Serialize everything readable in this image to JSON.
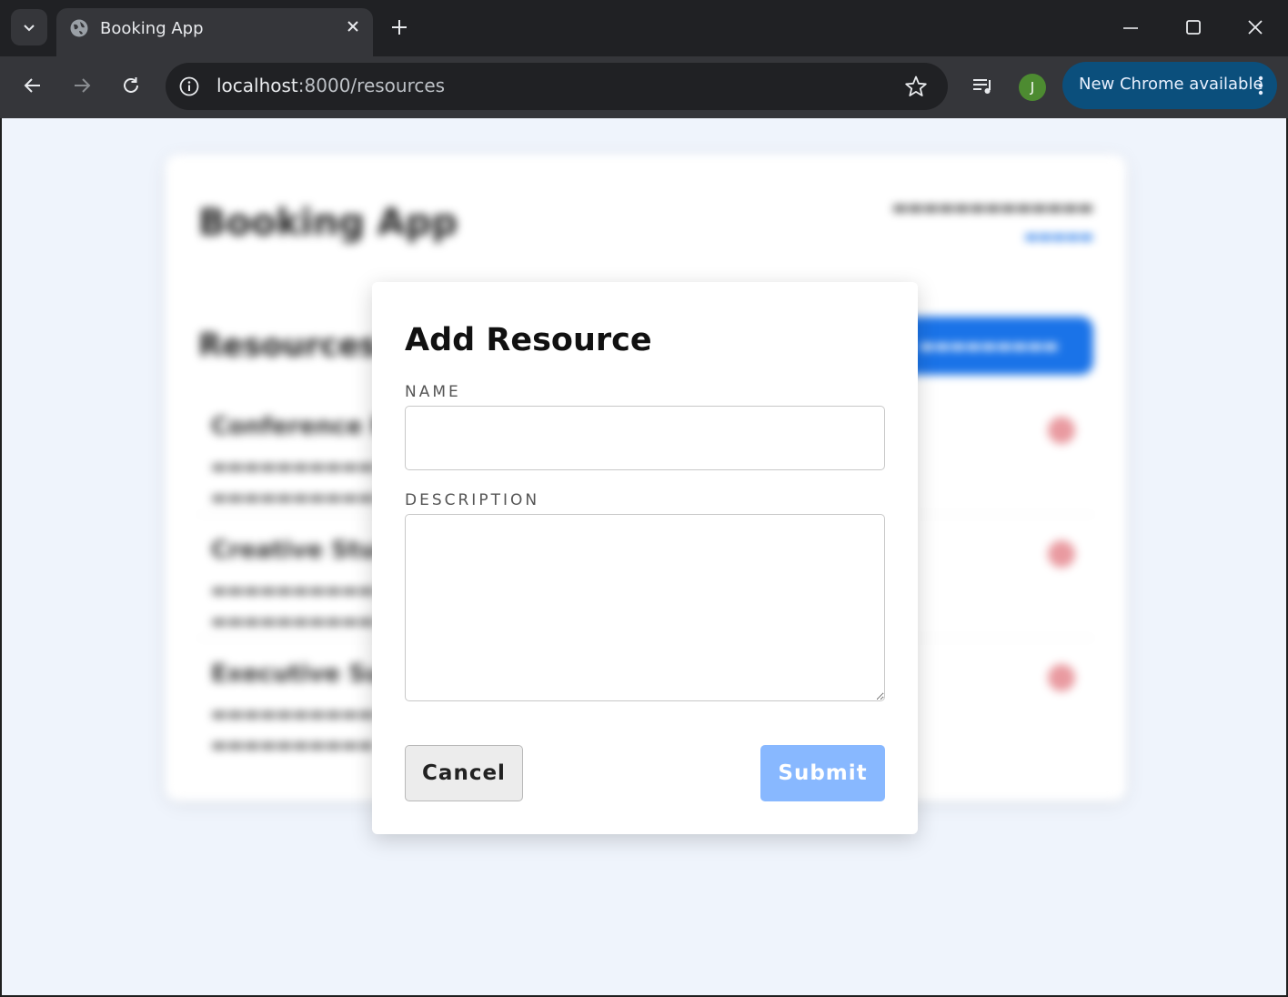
{
  "browser": {
    "tab_title": "Booking App",
    "url_host": "localhost",
    "url_path": ":8000/resources",
    "update_button_label": "New Chrome available",
    "avatar_initial": "J",
    "avatar_color": "#4d8b31",
    "update_button_color": "#0b4f7c"
  },
  "background_page": {
    "app_title": "Booking App",
    "section_heading": "Resources",
    "items": [
      {
        "name": "Conference Room A"
      },
      {
        "name": "Creative Studio"
      },
      {
        "name": "Executive Suite"
      }
    ]
  },
  "modal": {
    "title": "Add Resource",
    "name_label": "NAME",
    "name_value": "",
    "description_label": "DESCRIPTION",
    "description_value": "",
    "cancel_label": "Cancel",
    "submit_label": "Submit",
    "submit_color": "#88b8ff"
  }
}
